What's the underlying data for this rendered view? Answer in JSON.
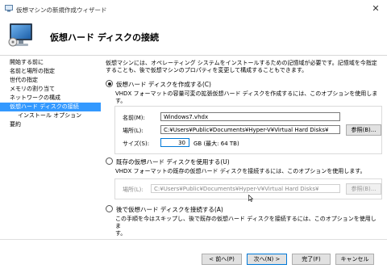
{
  "window": {
    "title": "仮想マシンの新規作成ウィザード",
    "icon": "hyperv-wizard-icon",
    "close_icon": "close-icon"
  },
  "header": {
    "title": "仮想ハード ディスクの接続",
    "icon": "virtual-disk-monitor-icon"
  },
  "sidebar": {
    "items": [
      {
        "label": "開始する前に",
        "active": false
      },
      {
        "label": "名前と場所の指定",
        "active": false
      },
      {
        "label": "世代の指定",
        "active": false
      },
      {
        "label": "メモリの割り当て",
        "active": false
      },
      {
        "label": "ネットワークの構成",
        "active": false
      },
      {
        "label": "仮想ハード ディスクの接続",
        "active": true
      },
      {
        "label": "インストール オプション",
        "active": false,
        "sub": true
      },
      {
        "label": "要約",
        "active": false
      }
    ]
  },
  "main": {
    "intro_line1": "仮想マシンには、オペレーティング システムをインストールするための記憶域が必要です。記憶域を今指定",
    "intro_line2": "することも、後で仮想マシンのプロパティを変更して構成することもできます。",
    "option_create": {
      "label": "仮想ハード ディスクを作成する(C)",
      "selected": true,
      "description": "VHDX フォーマットの容量可変の拡張仮想ハード ディスクを作成するには、このオプションを使用しま",
      "description2": "す。",
      "name_label": "名前(M):",
      "name_value": "Windows7.vhdx",
      "location_label": "場所(L):",
      "location_value": "C:¥Users¥Public¥Documents¥Hyper-V¥Virtual Hard Disks¥",
      "browse_label": "参照(B)...",
      "size_label": "サイズ(S):",
      "size_value": "30",
      "size_unit": "GB (最大: 64 TB)"
    },
    "option_existing": {
      "label": "既存の仮想ハード ディスクを使用する(U)",
      "selected": false,
      "description": "VHDX フォーマットの既存の仮想ハード ディスクを接続するには、このオプションを使用します。",
      "location_label": "場所(L):",
      "location_value": "C:¥Users¥Public¥Documents¥Hyper-V¥Virtual Hard Disks¥",
      "browse_label": "参照(B)..."
    },
    "option_later": {
      "label": "後で仮想ハード ディスクを接続する(A)",
      "selected": false,
      "description": "この手順を今はスキップし、後で既存の仮想ハード ディスクを接続するには、このオプションを使用しま",
      "description2": "す。"
    }
  },
  "footer": {
    "back": "< 前へ(P)",
    "next": "次へ(N) >",
    "finish": "完了(F)",
    "cancel": "キャンセル"
  }
}
